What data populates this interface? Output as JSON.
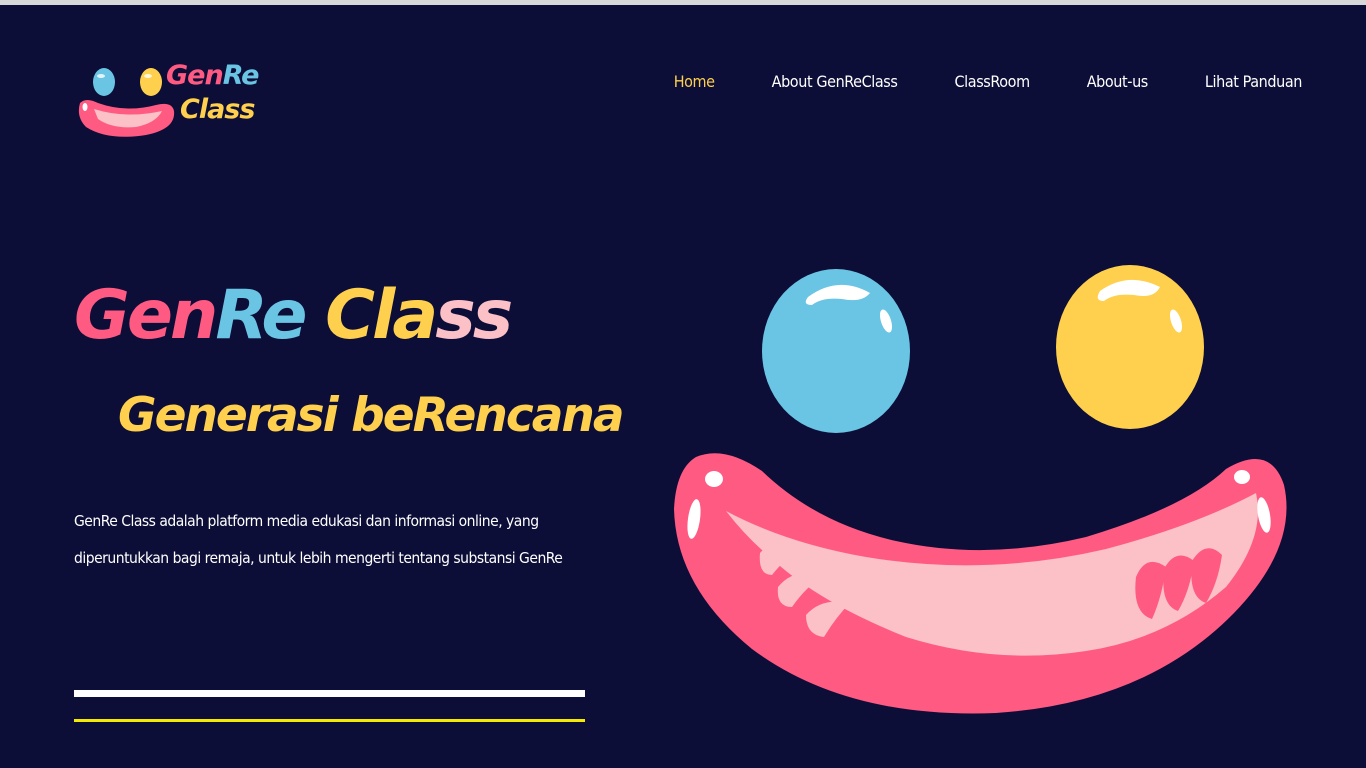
{
  "logo": {
    "line1_a": "Gen",
    "line1_b": "Re",
    "line2": "Class"
  },
  "nav": {
    "items": [
      {
        "label": "Home",
        "active": true
      },
      {
        "label": "About GenReClass",
        "active": false
      },
      {
        "label": "ClassRoom",
        "active": false
      },
      {
        "label": "About-us",
        "active": false
      },
      {
        "label": "Lihat Panduan",
        "active": false
      }
    ]
  },
  "hero": {
    "title_a": "Gen",
    "title_b": "Re",
    "title_c": "Cla",
    "title_d": "ss",
    "subtitle": "Generasi beRencana",
    "description": "GenRe Class adalah platform media edukasi dan informasi online, yang diperuntukkan bagi remaja, untuk lebih mengerti tentang substansi GenRe"
  },
  "colors": {
    "background": "#0c0e38",
    "pink": "#ff5a82",
    "light_pink": "#fcc0c7",
    "blue": "#69c5e3",
    "yellow": "#ffd04d",
    "nav_active": "#ffd04d",
    "rule_yellow": "#f5ea00"
  },
  "illustration": {
    "name": "smiley-face-illustration"
  }
}
